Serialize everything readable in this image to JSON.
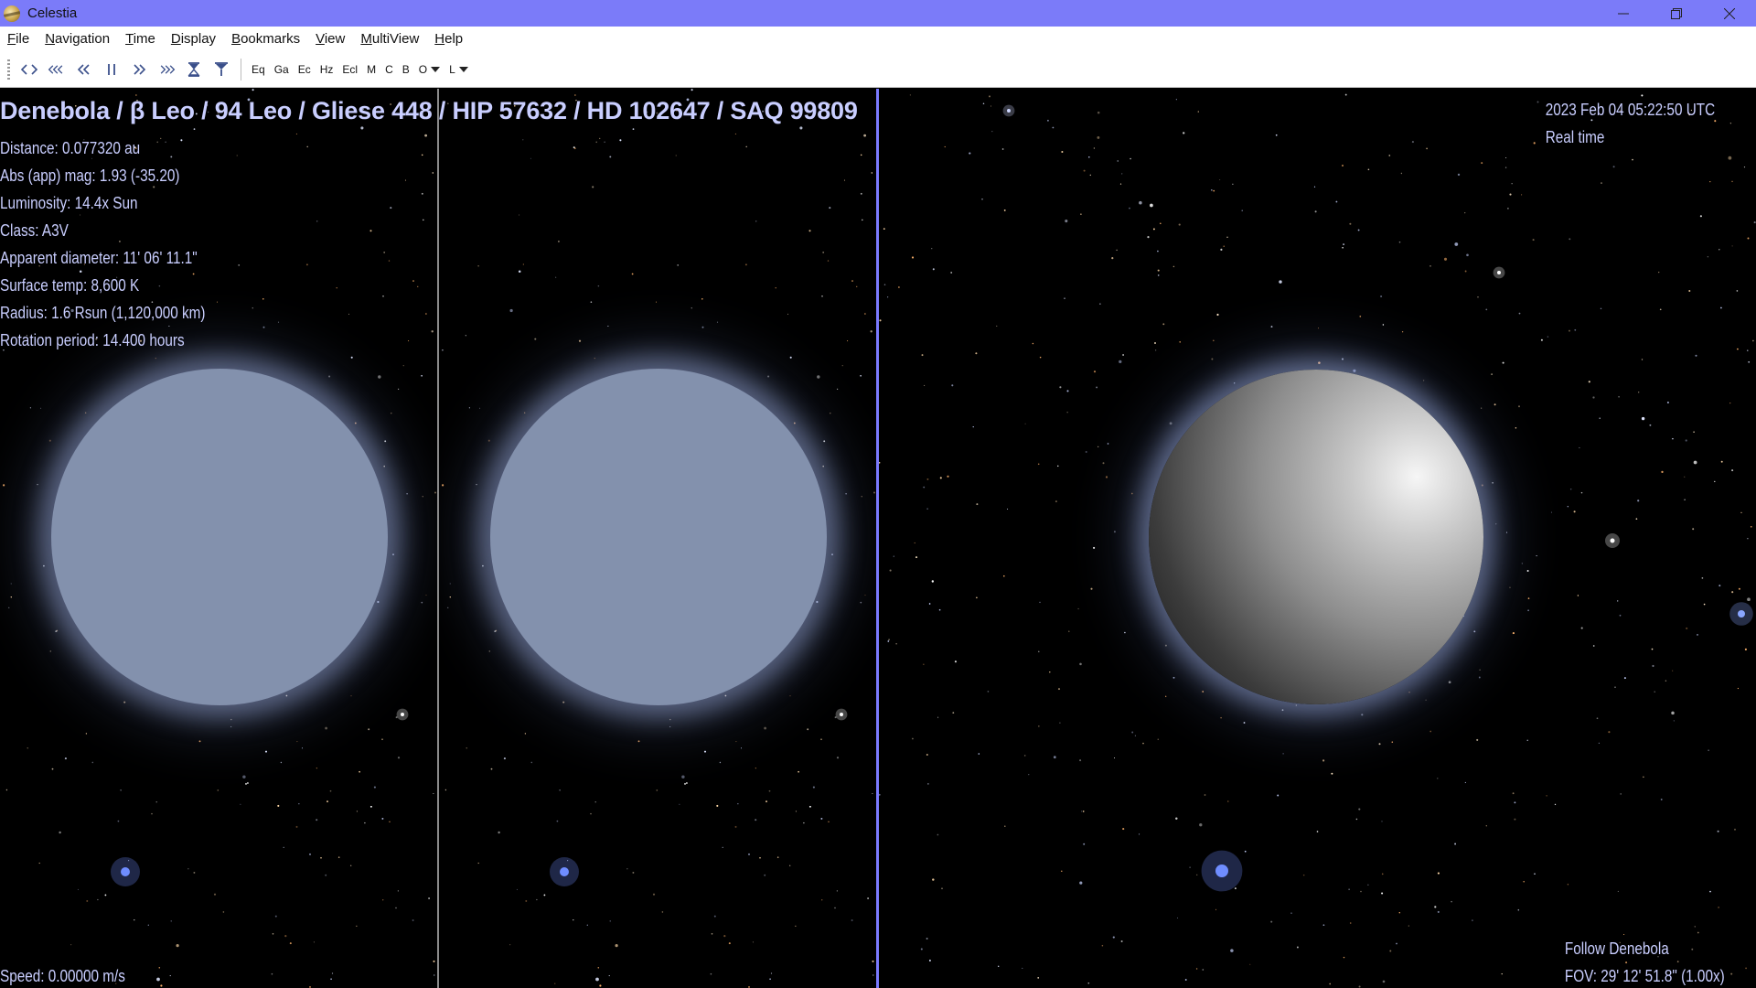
{
  "window": {
    "title": "Celestia",
    "controls": [
      "minimize",
      "restore",
      "close"
    ]
  },
  "menu": [
    {
      "u": "F",
      "rest": "ile"
    },
    {
      "u": "N",
      "rest": "avigation"
    },
    {
      "u": "T",
      "rest": "ime"
    },
    {
      "u": "D",
      "rest": "isplay"
    },
    {
      "u": "B",
      "rest": "ookmarks"
    },
    {
      "u": "V",
      "rest": "iew"
    },
    {
      "u": "M",
      "rest": "ultiView"
    },
    {
      "u": "H",
      "rest": "elp"
    }
  ],
  "toolbar": {
    "time_buttons": [
      "reverse-time-icon",
      "faster-reverse-icon",
      "slower-reverse-icon",
      "pause-icon",
      "slower-forward-icon",
      "faster-forward-icon",
      "hourglass-icon",
      "filter-icon"
    ],
    "labels": {
      "eq": "Eq",
      "ga": "Ga",
      "ec": "Ec",
      "hz": "Hz",
      "ecl": "Ecl",
      "m": "M",
      "c": "C",
      "b": "B",
      "o": "O",
      "l": "L"
    }
  },
  "hud": {
    "object_title": "Denebola / β Leo / 94 Leo / Gliese 448 / HIP 57632 / HD 102647 / SAQ 99809",
    "info": [
      "Distance: 0.077320 au",
      "Abs (app) mag: 1.93 (-35.20)",
      "Luminosity: 14.4x Sun",
      "Class: A3V",
      "Apparent diameter: 11' 06' 11.1\"",
      "Surface temp: 8,600 K",
      "Radius: 1.6 Rsun  (1,120,000 km)",
      "Rotation period: 14.400 hours"
    ],
    "datetime": "2023 Feb 04 05:22:50 UTC",
    "time_mode": "Real time",
    "speed": "Speed: 0.00000 m/s",
    "follow": "Follow Denebola",
    "fov": "FOV: 29' 12' 51.8\" (1.00x)"
  },
  "colors": {
    "titlebar": "#7b7bf9",
    "hud_text": "#c9ceff",
    "active_view_border": "#7a7aff",
    "divider": "#8a8a8a"
  }
}
